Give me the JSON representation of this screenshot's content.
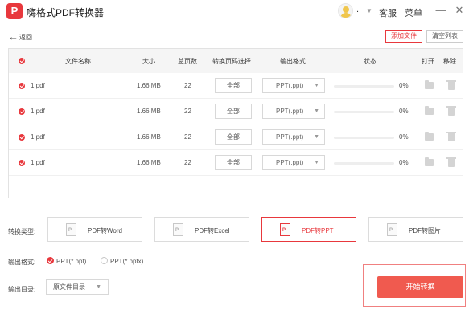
{
  "app": {
    "title": "嗨格式PDF转换器",
    "logo_letter": "P",
    "accent_color": "#e8383d"
  },
  "titlebar": {
    "user_name": ".",
    "service_label": "客服",
    "menu_label": "菜单",
    "minimize_glyph": "—",
    "close_glyph": "✕"
  },
  "toolbar": {
    "back_label": "返回",
    "add_file_label": "添加文件",
    "clear_list_label": "清空列表"
  },
  "table": {
    "headers": {
      "name": "文件名称",
      "size": "大小",
      "pages": "总页数",
      "page_select": "转换页码选择",
      "format": "输出格式",
      "status": "状态",
      "open": "打开",
      "remove": "移除"
    },
    "rows": [
      {
        "name": "1.pdf",
        "size": "1.66 MB",
        "pages": "22",
        "page_select": "全部",
        "format": "PPT(.ppt)",
        "progress": 0,
        "percent": "0%"
      },
      {
        "name": "1.pdf",
        "size": "1.66 MB",
        "pages": "22",
        "page_select": "全部",
        "format": "PPT(.ppt)",
        "progress": 0,
        "percent": "0%"
      },
      {
        "name": "1.pdf",
        "size": "1.66 MB",
        "pages": "22",
        "page_select": "全部",
        "format": "PPT(.ppt)",
        "progress": 0,
        "percent": "0%"
      },
      {
        "name": "1.pdf",
        "size": "1.66 MB",
        "pages": "22",
        "page_select": "全部",
        "format": "PPT(.ppt)",
        "progress": 0,
        "percent": "0%"
      }
    ]
  },
  "conversion": {
    "label": "转换类型:",
    "types": [
      {
        "label": "PDF转Word",
        "icon": "P",
        "active": false
      },
      {
        "label": "PDF转Excel",
        "icon": "P",
        "active": false
      },
      {
        "label": "PDF转PPT",
        "icon": "P",
        "active": true
      },
      {
        "label": "PDF转图片",
        "icon": "P",
        "active": false
      }
    ]
  },
  "output_format": {
    "label": "输出格式:",
    "options": [
      {
        "label": "PPT(*.ppt)",
        "checked": true
      },
      {
        "label": "PPT(*.pptx)",
        "checked": false
      }
    ]
  },
  "output_dir": {
    "label": "输出目录:",
    "value": "原文件目录"
  },
  "start_button": {
    "label": "开始转换"
  }
}
